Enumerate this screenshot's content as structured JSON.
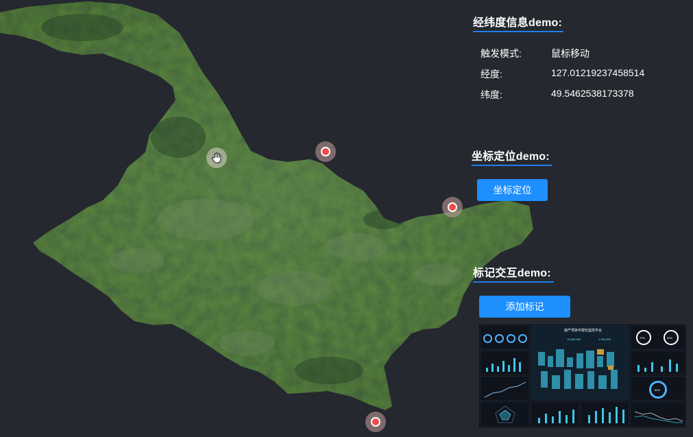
{
  "coordinate_panel": {
    "title": "经纬度信息demo:",
    "rows": [
      {
        "label": "触发模式:",
        "value": "鼠标移动"
      },
      {
        "label": "经度:",
        "value": "127.01219237458514"
      },
      {
        "label": "纬度:",
        "value": "49.5462538173378"
      }
    ]
  },
  "locate_panel": {
    "title": "坐标定位demo:",
    "button_label": "坐标定位"
  },
  "marker_panel": {
    "title": "标记交互demo:",
    "button_label": "添加标记"
  },
  "dashboard_thumbnail": {
    "title": "房产项目可视化监控平台",
    "stat_1": "12,520,000",
    "stat_2": "1,252,000",
    "ring_1": "70%",
    "ring_2": "80%",
    "ring_big": "80%"
  },
  "colors": {
    "background": "#25282f",
    "accent": "#1e8fff",
    "marker": "#f04a4a"
  }
}
